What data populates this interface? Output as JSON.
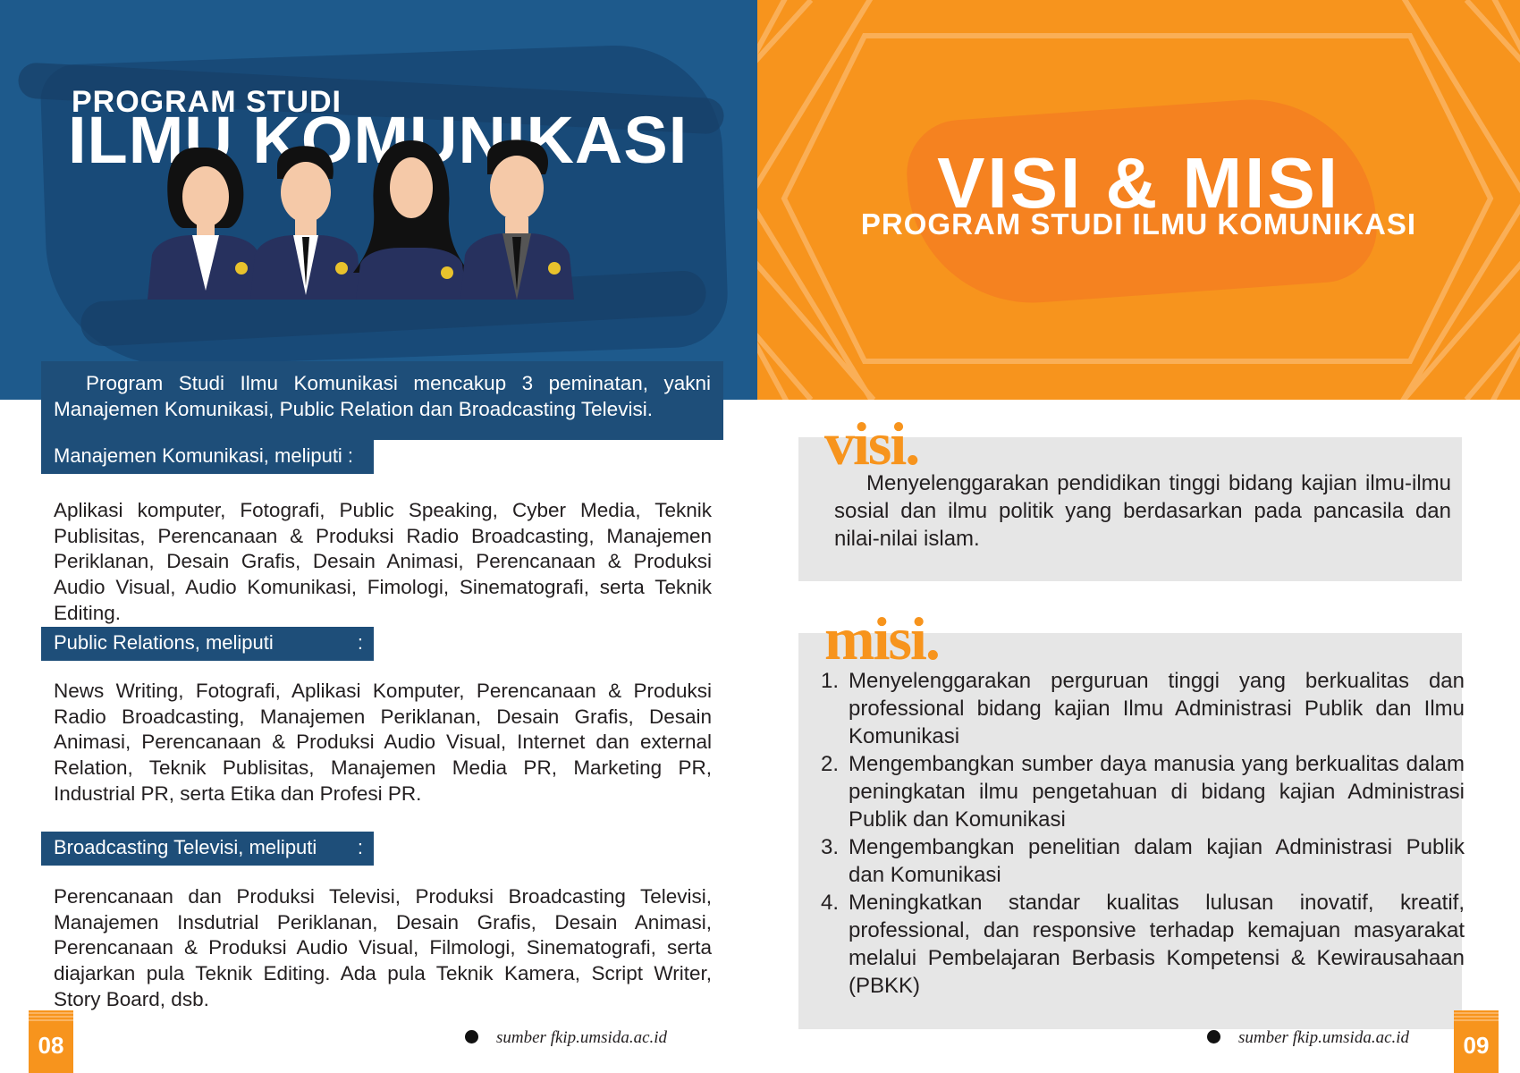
{
  "left": {
    "kicker": "PROGRAM STUDI",
    "title": "ILMU KOMUNIKASI",
    "intro": "Program Studi Ilmu Komunikasi mencakup 3 peminatan, yakni Manajemen Komunikasi, Public Relation dan Broadcasting Televisi.",
    "sections": [
      {
        "heading": "Manajemen Komunikasi, meliputi :",
        "text": "Aplikasi komputer, Fotografi, Public Speaking, Cyber Media, Teknik Publisitas, Perencanaan & Produksi Radio Broadcasting, Manajemen Periklanan, Desain Grafis, Desain Animasi, Perencanaan & Produksi Audio Visual, Audio Komunikasi, Fimologi, Sinematografi, serta Teknik Editing."
      },
      {
        "heading": "Public Relations, meliputi",
        "colon": ":",
        "text": "News Writing, Fotografi, Aplikasi Komputer, Perencanaan & Produksi Radio Broadcasting, Manajemen Periklanan, Desain Grafis, Desain Animasi, Perencanaan & Produksi Audio Visual, Internet dan external Relation, Teknik Publisitas, Manajemen Media PR, Marketing PR, Industrial PR, serta Etika dan Profesi PR."
      },
      {
        "heading": "Broadcasting Televisi, meliputi",
        "colon": ":",
        "text": "Perencanaan dan Produksi Televisi, Produksi Broadcasting Televisi, Manajemen Insdutrial Periklanan, Desain Grafis, Desain Animasi, Perencanaan & Produksi Audio Visual, Filmologi, Sinematografi, serta diajarkan pula Teknik Editing. Ada pula Teknik Kamera, Script Writer, Story Board, dsb."
      }
    ],
    "page_number": "08",
    "source": "sumber fkip.umsida.ac.id"
  },
  "right": {
    "title": "VISI & MISI",
    "subtitle": "PROGRAM STUDI ILMU KOMUNIKASI",
    "visi_heading": "visi.",
    "visi_text": "Menyelenggarakan pendidikan tinggi bidang kajian ilmu-ilmu sosial dan ilmu politik yang berdasarkan pada pancasila dan nilai-nilai islam.",
    "misi_heading": "misi.",
    "misi_items": [
      {
        "num": "1.",
        "text": "Menyelenggarakan perguruan tinggi yang berkualitas dan professional bidang kajian Ilmu Administrasi Publik dan Ilmu Komunikasi"
      },
      {
        "num": "2.",
        "text": "Mengembangkan sumber daya manusia yang berkualitas dalam peningkatan ilmu pengetahuan di bidang kajian Administrasi Publik dan Komunikasi"
      },
      {
        "num": "3.",
        "text": "Mengembangkan penelitian dalam kajian Administrasi Publik dan Komunikasi"
      },
      {
        "num": "4.",
        "text": "Meningkatkan standar kualitas lulusan inovatif, kreatif, professional, dan responsive terhadap kemajuan masyarakat melalui Pembelajaran Berbasis Kompetensi & Kewirausahaan (PBKK)"
      }
    ],
    "page_number": "09",
    "source": "sumber fkip.umsida.ac.id"
  },
  "colors": {
    "navy": "#1e5a8c",
    "navy_dark": "#1e4e79",
    "orange": "#f7941d",
    "grey_panel": "#e6e6e6"
  }
}
